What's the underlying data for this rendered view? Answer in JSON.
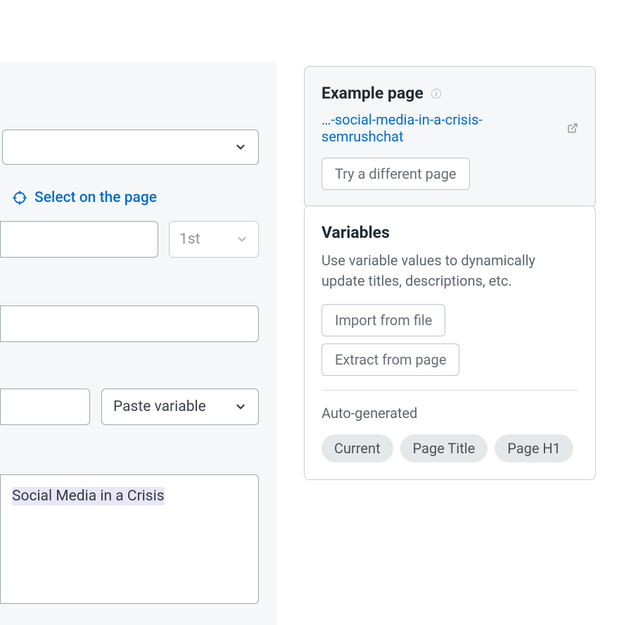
{
  "left": {
    "select_on_page": "Select on the page",
    "ordinal": "1st",
    "paste_variable": "Paste variable",
    "textarea_value": "Social Media in a Crisis"
  },
  "example_page": {
    "title": "Example page",
    "link_text": "…-social-media-in-a-crisis-semrushchat",
    "try_different": "Try a different page"
  },
  "variables": {
    "title": "Variables",
    "subtext": "Use variable values to dynamically update titles, descriptions, etc.",
    "import_button": "Import from file",
    "extract_button": "Extract from page",
    "auto_generated_label": "Auto-generated",
    "chips": [
      "Current",
      "Page Title",
      "Page H1"
    ]
  }
}
